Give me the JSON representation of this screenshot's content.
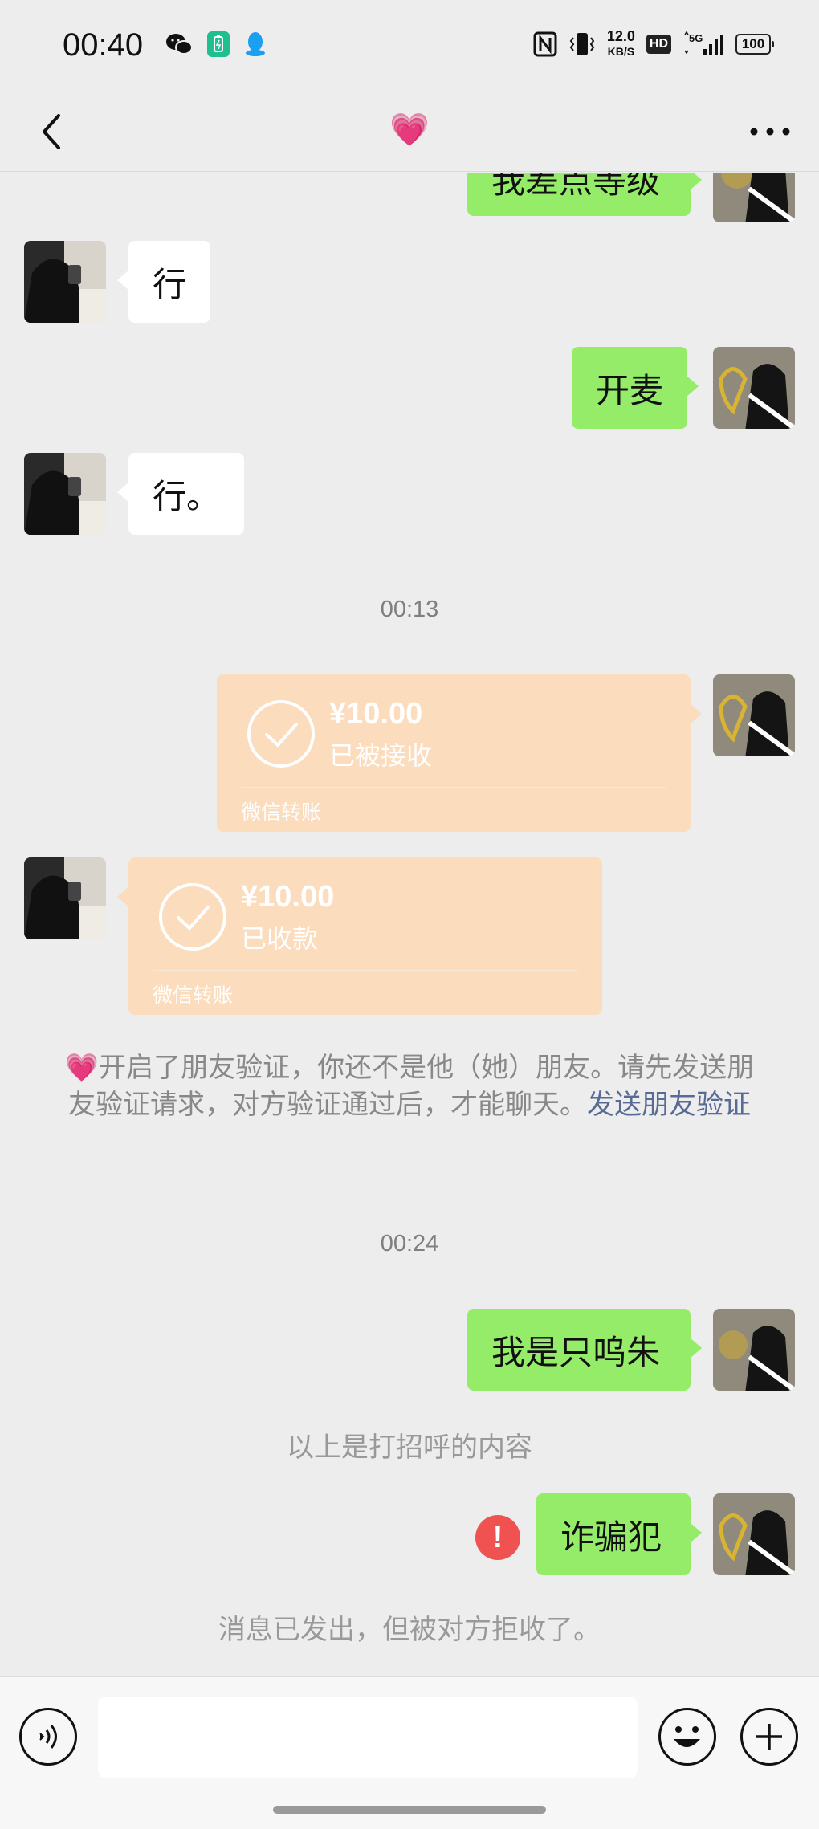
{
  "status_bar": {
    "time": "00:40",
    "left_icons": [
      "wechat-icon",
      "battery-saver-icon",
      "qq-icon"
    ],
    "right_icons": [
      "nfc-icon",
      "vibrate-icon",
      "hd-icon",
      "signal-5g-icon",
      "battery-icon"
    ],
    "net_speed_value": "12.0",
    "net_speed_unit": "KB/S",
    "hd_label": "HD",
    "network_label": "5G",
    "battery_level": "100"
  },
  "nav": {
    "title": "💗",
    "back_icon": "chevron-left-icon",
    "more_icon": "more-dots-icon"
  },
  "messages": [
    {
      "side": "me",
      "type": "text",
      "text": "我差点等级"
    },
    {
      "side": "other",
      "type": "text",
      "text": "行"
    },
    {
      "side": "me",
      "type": "text",
      "text": "开麦"
    },
    {
      "side": "other",
      "type": "text",
      "text": "行。"
    },
    {
      "type": "time",
      "text": "00:13"
    },
    {
      "side": "me",
      "type": "transfer",
      "amount": "¥10.00",
      "status": "已被接收",
      "footer": "微信转账"
    },
    {
      "side": "other",
      "type": "transfer",
      "amount": "¥10.00",
      "status": "已收款",
      "footer": "微信转账"
    },
    {
      "type": "system",
      "text_prefix": "💗开启了朋友验证，你还不是他（她）朋友。请先发送朋友验证请求，对方验证通过后，才能聊天。",
      "link_text": "发送朋友验证"
    },
    {
      "type": "time",
      "text": "00:24"
    },
    {
      "side": "me",
      "type": "text",
      "text": "我是只呜朱"
    },
    {
      "type": "system-small",
      "text": "以上是打招呼的内容"
    },
    {
      "side": "me",
      "type": "text",
      "text": "诈骗犯",
      "failed": true,
      "error_symbol": "!"
    },
    {
      "type": "system-small",
      "text": "消息已发出，但被对方拒收了。"
    }
  ],
  "input_bar": {
    "voice_icon": "voice-input-icon",
    "emoji_icon": "emoji-icon",
    "plus_icon": "plus-icon",
    "placeholder": ""
  },
  "colors": {
    "background": "#ededed",
    "my_bubble": "#95ec69",
    "other_bubble": "#ffffff",
    "transfer_bubble": "#fbdcbd",
    "link": "#576b95",
    "error": "#f05151"
  }
}
